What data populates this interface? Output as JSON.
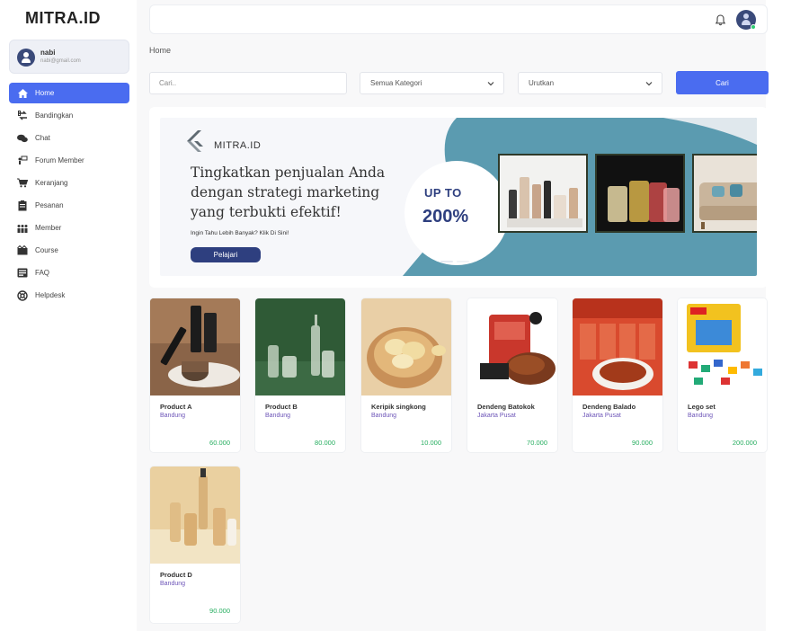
{
  "app": {
    "brand": "MITRA.ID"
  },
  "user": {
    "name": "nabi",
    "email": "nabi@gmail.com"
  },
  "sidebar": {
    "items": [
      {
        "label": "Home",
        "icon": "home-icon"
      },
      {
        "label": "Bandingkan",
        "icon": "compare-icon"
      },
      {
        "label": "Chat",
        "icon": "chat-icon"
      },
      {
        "label": "Forum Member",
        "icon": "forum-icon"
      },
      {
        "label": "Keranjang",
        "icon": "cart-icon"
      },
      {
        "label": "Pesanan",
        "icon": "orders-icon"
      },
      {
        "label": "Member",
        "icon": "members-icon"
      },
      {
        "label": "Course",
        "icon": "course-icon"
      },
      {
        "label": "FAQ",
        "icon": "faq-icon"
      },
      {
        "label": "Helpdesk",
        "icon": "helpdesk-icon"
      }
    ]
  },
  "header": {
    "breadcrumb": "Home"
  },
  "filters": {
    "search_placeholder": "Cari..",
    "category": "Semua Kategori",
    "sort": "Urutkan",
    "search_button": "Cari"
  },
  "banner": {
    "logo_text": "MITRA.ID",
    "headline_1": "Tingkatkan penjualan Anda",
    "headline_2": "dengan strategi marketing",
    "headline_3": "yang terbukti efektif!",
    "subtext": "Ingin Tahu Lebih Banyak? Klik Di Sini!",
    "button": "Pelajari",
    "upto": "UP TO",
    "percent": "200%"
  },
  "products": [
    {
      "name": "Product A",
      "city": "Bandung",
      "price": "60.000"
    },
    {
      "name": "Product B",
      "city": "Bandung",
      "price": "80.000"
    },
    {
      "name": "Keripik singkong",
      "city": "Bandung",
      "price": "10.000"
    },
    {
      "name": "Dendeng Batokok",
      "city": "Jakarta Pusat",
      "price": "70.000"
    },
    {
      "name": "Dendeng Balado",
      "city": "Jakarta Pusat",
      "price": "90.000"
    },
    {
      "name": "Lego set",
      "city": "Bandung",
      "price": "200.000"
    },
    {
      "name": "Product D",
      "city": "Bandung",
      "price": "90.000"
    }
  ],
  "colors": {
    "accent": "#4a6cf0",
    "price": "#27ae60",
    "city": "#6d55b8",
    "banner_teal": "#5b9bb0",
    "banner_navy": "#2e3f7f"
  }
}
